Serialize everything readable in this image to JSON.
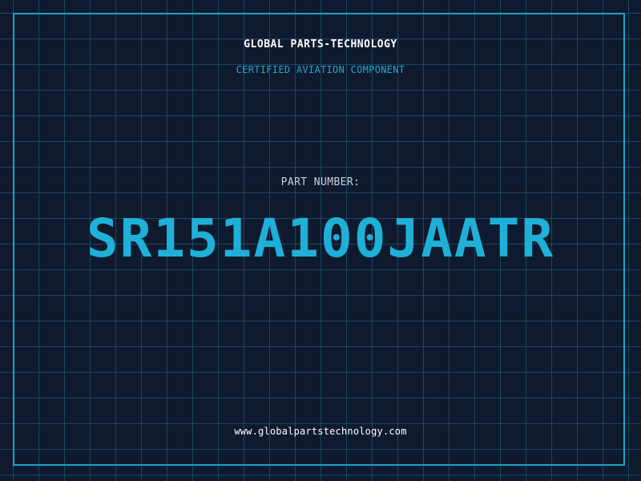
{
  "header": {
    "company": "GLOBAL PARTS-TECHNOLOGY",
    "subtitle": "CERTIFIED AVIATION COMPONENT"
  },
  "part": {
    "label": "PART NUMBER:",
    "number": "SR151A100JAATR"
  },
  "footer": {
    "website": "www.globalpartstechnology.com"
  },
  "colors": {
    "background": "#101a2e",
    "grid": "#1e6e8c",
    "accent": "#1fb0d8",
    "frame": "#1aa3c8"
  }
}
